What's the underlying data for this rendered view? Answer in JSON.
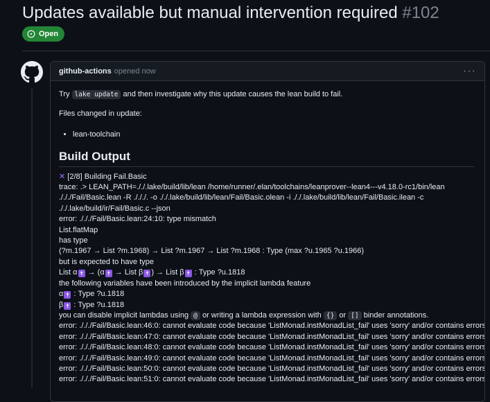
{
  "issue": {
    "title": "Updates available but manual intervention required",
    "number": "#102",
    "state": "Open"
  },
  "comment": {
    "author": "github-actions",
    "meta": "opened now",
    "intro_before": "Try",
    "intro_code": "lake update",
    "intro_after": "and then investigate why this update causes the lean build to fail.",
    "files_label": "Files changed in update:",
    "files": [
      "lean-toolchain"
    ],
    "build_heading": "Build Output",
    "log": {
      "building": "[2/8] Building Fail.Basic",
      "trace1": "trace: .> LEAN_PATH=././.lake/build/lib/lean /home/runner/.elan/toolchains/leanprover--lean4---v4.18.0-rc1/bin/lean",
      "trace2": "./././Fail/Basic.lean -R ./././. -o ././.lake/build/lib/lean/Fail/Basic.olean -i ././.lake/build/lib/lean/Fail/Basic.ilean -c",
      "trace3": "././.lake/build/ir/Fail/Basic.c --json",
      "error1": "error: ./././Fail/Basic.lean:24:10: type mismatch",
      "flatmap": "List.flatMap",
      "has_type": "has type",
      "type_sig": "(?m.1967 → List ?m.1968) → List ?m.1967 → List ?m.1968 : Type (max ?u.1965 ?u.1966)",
      "expected": "but is expected to have type",
      "exp_a": "List α",
      "exp_b": "→ (α",
      "exp_c": "→ List β",
      "exp_d": ") → List β",
      "exp_e": ": Type ?u.1818",
      "implicit": "the following variables have been introduced by the implicit lambda feature",
      "alpha_name": "α",
      "alpha_type": ": Type ?u.1818",
      "beta_name": "β",
      "beta_type": ": Type ?u.1818",
      "disable_a": "you can disable implicit lambdas using",
      "disable_code1": "@",
      "disable_b": "or writing a lambda expression with",
      "disable_code2": "{}",
      "disable_c": "or",
      "disable_code3": "[]",
      "disable_d": "binder annotations.",
      "kbd_glyph": "✝",
      "sorry_errors": [
        "error: ./././Fail/Basic.lean:46:0: cannot evaluate code because 'ListMonad.instMonadList_fail' uses 'sorry' and/or contains errors",
        "error: ./././Fail/Basic.lean:47:0: cannot evaluate code because 'ListMonad.instMonadList_fail' uses 'sorry' and/or contains errors",
        "error: ./././Fail/Basic.lean:48:0: cannot evaluate code because 'ListMonad.instMonadList_fail' uses 'sorry' and/or contains errors",
        "error: ./././Fail/Basic.lean:49:0: cannot evaluate code because 'ListMonad.instMonadList_fail' uses 'sorry' and/or contains errors",
        "error: ./././Fail/Basic.lean:50:0: cannot evaluate code because 'ListMonad.instMonadList_fail' uses 'sorry' and/or contains errors",
        "error: ./././Fail/Basic.lean:51:0: cannot evaluate code because 'ListMonad.instMonadList_fail' uses 'sorry' and/or contains errors"
      ]
    }
  },
  "colors": {
    "background": "#0d1117",
    "open_badge": "#238636",
    "accent_purple": "#8957e5",
    "border": "#30363d"
  },
  "icons": {
    "state": "issue-opened-icon",
    "avatar": "github-mark-icon",
    "menu": "kebab-horizontal-icon",
    "build_status": "x-icon"
  }
}
